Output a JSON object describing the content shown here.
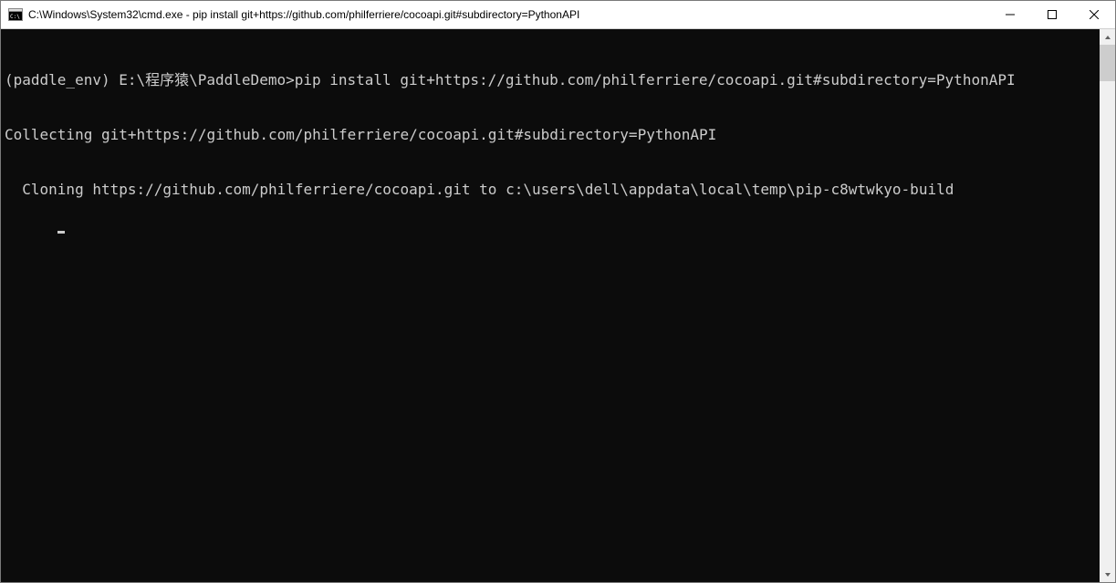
{
  "window": {
    "title": "C:\\Windows\\System32\\cmd.exe - pip  install git+https://github.com/philferriere/cocoapi.git#subdirectory=PythonAPI"
  },
  "terminal": {
    "lines": [
      "(paddle_env) E:\\程序猿\\PaddleDemo>pip install git+https://github.com/philferriere/cocoapi.git#subdirectory=PythonAPI",
      "Collecting git+https://github.com/philferriere/cocoapi.git#subdirectory=PythonAPI",
      "  Cloning https://github.com/philferriere/cocoapi.git to c:\\users\\dell\\appdata\\local\\temp\\pip-c8wtwkyo-build"
    ]
  }
}
